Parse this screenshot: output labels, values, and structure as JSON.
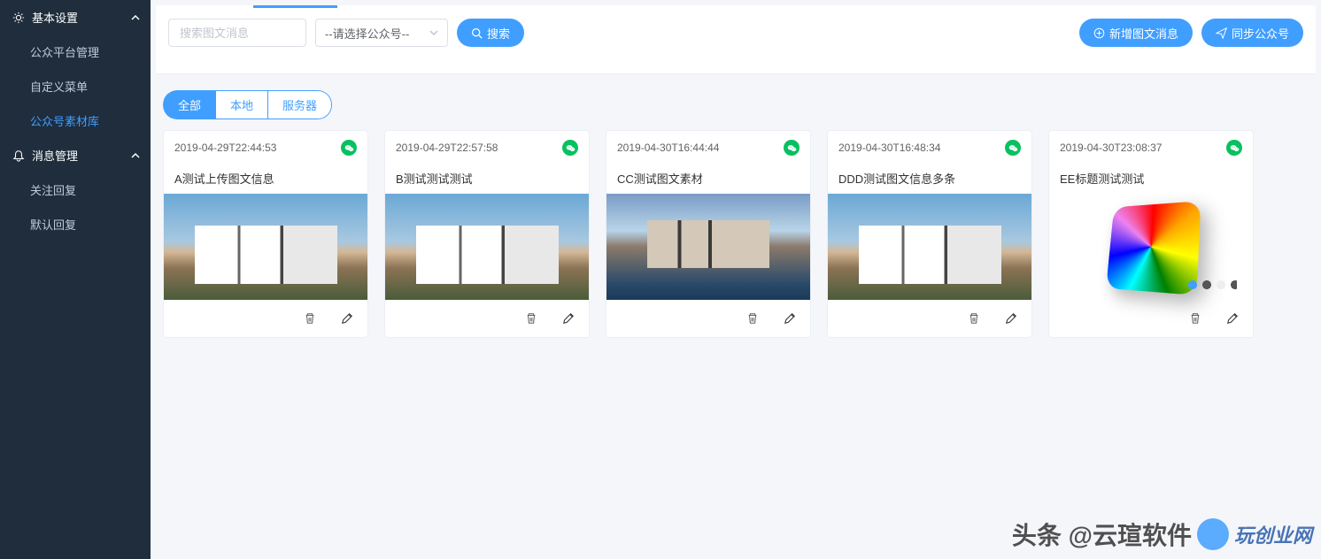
{
  "sidebar": {
    "groups": [
      {
        "label": "基本设置",
        "icon": "gear-icon",
        "items": [
          {
            "label": "公众平台管理",
            "active": false
          },
          {
            "label": "自定义菜单",
            "active": false
          },
          {
            "label": "公众号素材库",
            "active": true
          }
        ]
      },
      {
        "label": "消息管理",
        "icon": "bell-icon",
        "items": [
          {
            "label": "关注回复",
            "active": false
          },
          {
            "label": "默认回复",
            "active": false
          }
        ]
      }
    ]
  },
  "toolbar": {
    "search_placeholder": "搜索图文消息",
    "select_placeholder": "--请选择公众号--",
    "search_button": "搜索",
    "add_button": "新增图文消息",
    "sync_button": "同步公众号"
  },
  "tabs": [
    {
      "label": "全部",
      "active": true
    },
    {
      "label": "本地",
      "active": false
    },
    {
      "label": "服务器",
      "active": false
    }
  ],
  "cards": [
    {
      "timestamp": "2019-04-29T22:44:53",
      "title": "A测试上传图文信息",
      "image_type": "building"
    },
    {
      "timestamp": "2019-04-29T22:57:58",
      "title": "B测试测试测试",
      "image_type": "building"
    },
    {
      "timestamp": "2019-04-30T16:44:44",
      "title": "CC测试图文素材",
      "image_type": "building-pool"
    },
    {
      "timestamp": "2019-04-30T16:48:34",
      "title": "DDD测试图文信息多条",
      "image_type": "building"
    },
    {
      "timestamp": "2019-04-30T23:08:37",
      "title": "EE标题测试测试",
      "image_type": "phone"
    }
  ],
  "watermark": {
    "text1": "头条 @云瑄软件",
    "text2": "玩创业网"
  }
}
